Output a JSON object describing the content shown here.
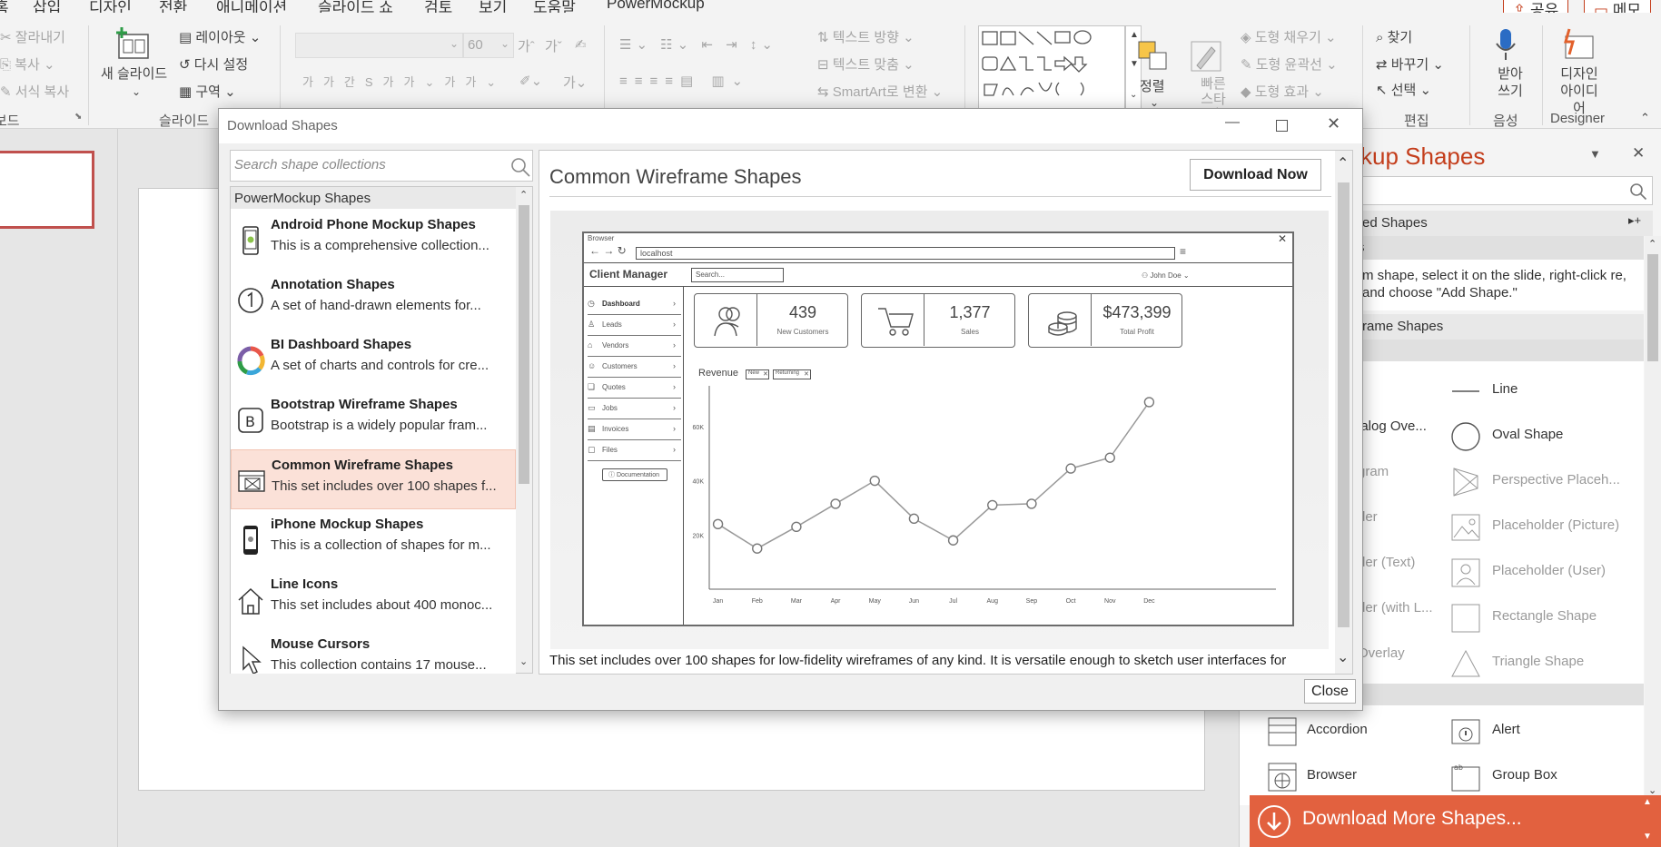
{
  "ribbon": {
    "menu_tabs": [
      "홈",
      "삽입",
      "디자인",
      "전환",
      "애니메이션",
      "슬라이드 쇼",
      "검토",
      "보기",
      "도움말",
      "PowerMockup"
    ],
    "share_label": "공유",
    "memo_label": "메모",
    "clipboard": {
      "cut": "잘라내기",
      "copy": "복사",
      "format_copy": "서식 복사",
      "group_label": "보드"
    },
    "slides": {
      "new_slide": "새 슬라이드",
      "layout": "레이아웃",
      "reset": "다시 설정",
      "section": "구역",
      "group_label": "슬라이드"
    },
    "font": {
      "size_value": "60"
    },
    "paragraph": {
      "text_direction": "텍스트 방향",
      "text_align": "텍스트 맞춤",
      "smartart": "SmartArt로 변환"
    },
    "drawing": {
      "arrange": "정렬",
      "quick_styles": "빠른 스타일",
      "shape_fill": "도형 채우기",
      "shape_outline": "도형 윤곽선",
      "shape_effects": "도형 효과"
    },
    "editing": {
      "find": "찾기",
      "replace": "바꾸기",
      "select": "선택",
      "group_label": "편집"
    },
    "voice": {
      "dictate": "받아 쓰기",
      "group_label": "음성"
    },
    "designer": {
      "label": "디자인 아이디어",
      "group_label": "Designer"
    }
  },
  "pane": {
    "title": "ckup Shapes",
    "favorites_header": "ed Shapes",
    "section_header_clipped": "s",
    "help_text": "m shape, select it on the slide, right-click re, and choose \"Add Shape.\"",
    "category_header": "rame Shapes",
    "shapes_left": [
      "ialog Ove...",
      "gram",
      "der",
      "der (Text)",
      "der (with L...",
      "Overlay"
    ],
    "shapes_right": [
      "Line",
      "Oval Shape",
      "Perspective Placeh...",
      "Placeholder (Picture)",
      "Placeholder (User)",
      "Rectangle Shape",
      "Triangle Shape"
    ],
    "bottom_shapes": [
      "Accordion",
      "Alert",
      "Browser",
      "Group Box"
    ],
    "download_more": "Download More Shapes..."
  },
  "dialog": {
    "title": "Download Shapes",
    "search_placeholder": "Search shape collections",
    "list_header": "PowerMockup Shapes",
    "collections": [
      {
        "name": "Android Phone Mockup Shapes",
        "desc": "This is a comprehensive collection..."
      },
      {
        "name": "Annotation Shapes",
        "desc": "A set of hand-drawn elements for..."
      },
      {
        "name": "BI Dashboard Shapes",
        "desc": "A set of charts and controls for cre..."
      },
      {
        "name": "Bootstrap Wireframe Shapes",
        "desc": "Bootstrap is a widely popular fram..."
      },
      {
        "name": "Common Wireframe Shapes",
        "desc": "This set includes over 100 shapes f..."
      },
      {
        "name": "iPhone Mockup Shapes",
        "desc": "This is a collection of shapes for m..."
      },
      {
        "name": "Line Icons",
        "desc": "This set includes about 400 monoc..."
      },
      {
        "name": "Mouse Cursors",
        "desc": "This collection contains 17 mouse..."
      }
    ],
    "selected_index": 4,
    "detail_title": "Common Wireframe Shapes",
    "download_now": "Download Now",
    "description": "This set includes over 100 shapes for low-fidelity wireframes of any kind. It is versatile enough to sketch user interfaces for",
    "close_label": "Close"
  },
  "preview": {
    "browser_label": "Browser",
    "url": "localhost",
    "app_title": "Client Manager",
    "search_placeholder": "Search...",
    "user": "John Doe",
    "nav": [
      "Dashboard",
      "Leads",
      "Vendors",
      "Customers",
      "Quotes",
      "Jobs",
      "Invoices",
      "Files"
    ],
    "documentation": "Documentation",
    "kpis": [
      {
        "value": "439",
        "label": "New Customers",
        "icon": "users-icon"
      },
      {
        "value": "1,377",
        "label": "Sales",
        "icon": "cart-icon"
      },
      {
        "value": "$473,399",
        "label": "Total Profit",
        "icon": "coins-icon"
      }
    ],
    "chart_title": "Revenue",
    "filter_tags": [
      "New",
      "Returning"
    ]
  },
  "chart_data": {
    "type": "line",
    "title": "Revenue",
    "categories": [
      "Jan",
      "Feb",
      "Mar",
      "Apr",
      "May",
      "Jun",
      "Jul",
      "Aug",
      "Sep",
      "Oct",
      "Nov",
      "Dec"
    ],
    "values": [
      24000,
      15000,
      23000,
      31500,
      40000,
      26000,
      18000,
      31000,
      31500,
      44500,
      48500,
      69000
    ],
    "y_ticks": [
      "20K",
      "40K",
      "60K"
    ],
    "ylim": [
      0,
      75000
    ],
    "grid": false
  }
}
